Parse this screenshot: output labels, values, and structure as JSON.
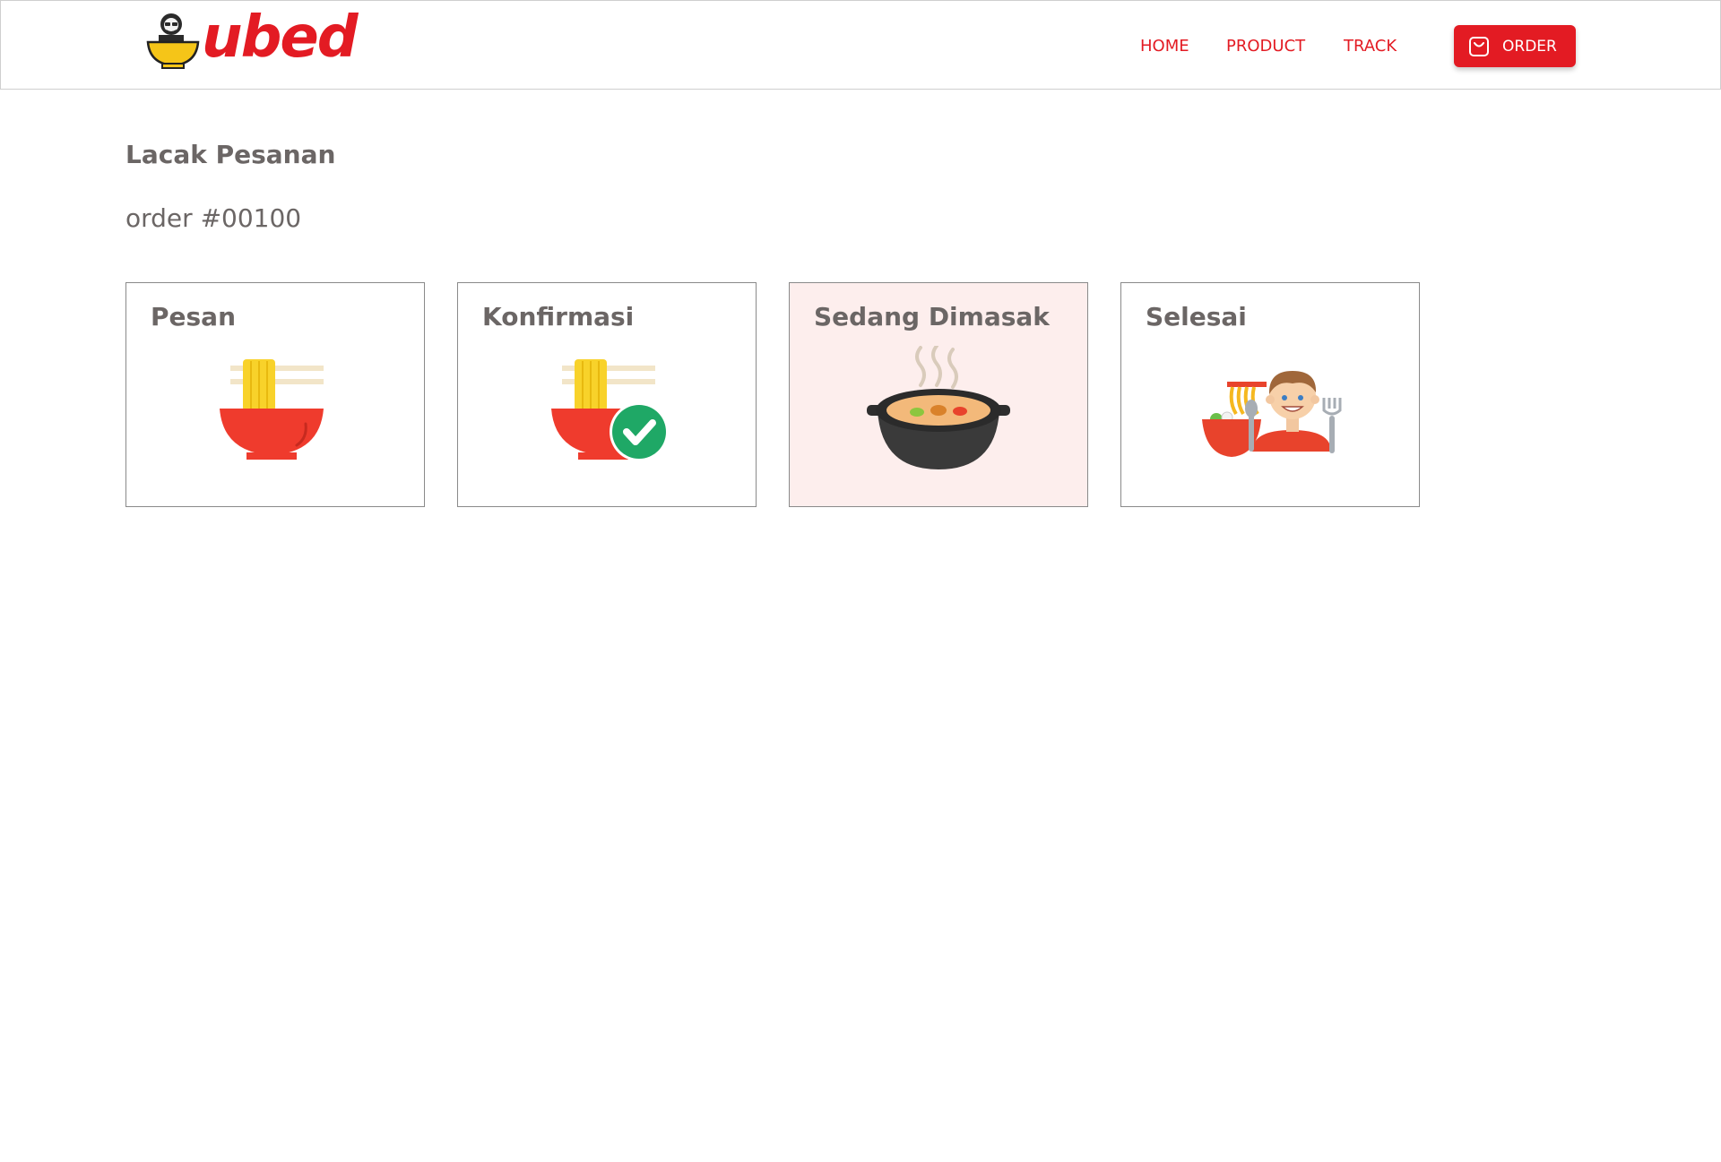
{
  "header": {
    "brand": "ubed",
    "nav": {
      "home": "HOME",
      "product": "PRODUCT",
      "track": "TRACK"
    },
    "order_button": "ORDER"
  },
  "page": {
    "title": "Lacak Pesanan",
    "order_number": "order #00100"
  },
  "steps": [
    {
      "label": "Pesan",
      "icon": "noodle-bowl-icon"
    },
    {
      "label": "Konfirmasi",
      "icon": "noodle-bowl-check-icon"
    },
    {
      "label": "Sedang Dimasak",
      "icon": "cooking-pot-icon"
    },
    {
      "label": "Selesai",
      "icon": "man-eating-noodles-icon"
    }
  ],
  "active_step": "Sedang Dimasak",
  "colors": {
    "brand": "#e31b23",
    "active_card": "#fdeeed",
    "text": "#6b6665"
  }
}
